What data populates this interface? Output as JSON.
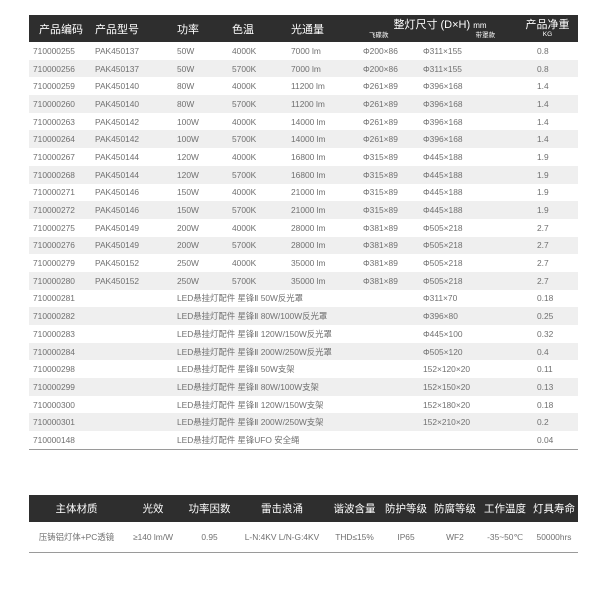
{
  "product_table": {
    "headers": {
      "code": "产品编码",
      "model": "产品型号",
      "power": "功率",
      "color_temp": "色温",
      "lumen": "光通量",
      "size": "整灯尺寸 (D×H)",
      "size_unit": "mm",
      "size_sub1": "飞碟款",
      "size_sub2": "带罩款",
      "weight": "产品净重",
      "weight_unit": "KG"
    },
    "rows": [
      {
        "code": "710000255",
        "model": "PAK450137",
        "power": "50W",
        "cct": "4000K",
        "lumen": "7000 lm",
        "ufo": "Φ200×86",
        "cover": "Φ311×155",
        "acc": "",
        "weight": "0.8"
      },
      {
        "code": "710000256",
        "model": "PAK450137",
        "power": "50W",
        "cct": "5700K",
        "lumen": "7000 lm",
        "ufo": "Φ200×86",
        "cover": "Φ311×155",
        "acc": "",
        "weight": "0.8"
      },
      {
        "code": "710000259",
        "model": "PAK450140",
        "power": "80W",
        "cct": "4000K",
        "lumen": "11200 lm",
        "ufo": "Φ261×89",
        "cover": "Φ396×168",
        "acc": "",
        "weight": "1.4"
      },
      {
        "code": "710000260",
        "model": "PAK450140",
        "power": "80W",
        "cct": "5700K",
        "lumen": "11200 lm",
        "ufo": "Φ261×89",
        "cover": "Φ396×168",
        "acc": "",
        "weight": "1.4"
      },
      {
        "code": "710000263",
        "model": "PAK450142",
        "power": "100W",
        "cct": "4000K",
        "lumen": "14000 lm",
        "ufo": "Φ261×89",
        "cover": "Φ396×168",
        "acc": "",
        "weight": "1.4"
      },
      {
        "code": "710000264",
        "model": "PAK450142",
        "power": "100W",
        "cct": "5700K",
        "lumen": "14000 lm",
        "ufo": "Φ261×89",
        "cover": "Φ396×168",
        "acc": "",
        "weight": "1.4"
      },
      {
        "code": "710000267",
        "model": "PAK450144",
        "power": "120W",
        "cct": "4000K",
        "lumen": "16800 lm",
        "ufo": "Φ315×89",
        "cover": "Φ445×188",
        "acc": "",
        "weight": "1.9"
      },
      {
        "code": "710000268",
        "model": "PAK450144",
        "power": "120W",
        "cct": "5700K",
        "lumen": "16800 lm",
        "ufo": "Φ315×89",
        "cover": "Φ445×188",
        "acc": "",
        "weight": "1.9"
      },
      {
        "code": "710000271",
        "model": "PAK450146",
        "power": "150W",
        "cct": "4000K",
        "lumen": "21000 lm",
        "ufo": "Φ315×89",
        "cover": "Φ445×188",
        "acc": "",
        "weight": "1.9"
      },
      {
        "code": "710000272",
        "model": "PAK450146",
        "power": "150W",
        "cct": "5700K",
        "lumen": "21000 lm",
        "ufo": "Φ315×89",
        "cover": "Φ445×188",
        "acc": "",
        "weight": "1.9"
      },
      {
        "code": "710000275",
        "model": "PAK450149",
        "power": "200W",
        "cct": "4000K",
        "lumen": "28000 lm",
        "ufo": "Φ381×89",
        "cover": "Φ505×218",
        "acc": "",
        "weight": "2.7"
      },
      {
        "code": "710000276",
        "model": "PAK450149",
        "power": "200W",
        "cct": "5700K",
        "lumen": "28000 lm",
        "ufo": "Φ381×89",
        "cover": "Φ505×218",
        "acc": "",
        "weight": "2.7"
      },
      {
        "code": "710000279",
        "model": "PAK450152",
        "power": "250W",
        "cct": "4000K",
        "lumen": "35000 lm",
        "ufo": "Φ381×89",
        "cover": "Φ505×218",
        "acc": "",
        "weight": "2.7"
      },
      {
        "code": "710000280",
        "model": "PAK450152",
        "power": "250W",
        "cct": "5700K",
        "lumen": "35000 lm",
        "ufo": "Φ381×89",
        "cover": "Φ505×218",
        "acc": "",
        "weight": "2.7"
      },
      {
        "code": "710000281",
        "model": "",
        "power": "",
        "cct": "",
        "lumen": "",
        "ufo": "",
        "cover": "Φ311×70",
        "acc": "LED悬挂灯配件 星锋Ⅱ 50W反光罩",
        "weight": "0.18"
      },
      {
        "code": "710000282",
        "model": "",
        "power": "",
        "cct": "",
        "lumen": "",
        "ufo": "",
        "cover": "Φ396×80",
        "acc": "LED悬挂灯配件 星锋Ⅱ 80W/100W反光罩",
        "weight": "0.25"
      },
      {
        "code": "710000283",
        "model": "",
        "power": "",
        "cct": "",
        "lumen": "",
        "ufo": "",
        "cover": "Φ445×100",
        "acc": "LED悬挂灯配件 星锋Ⅱ 120W/150W反光罩",
        "weight": "0.32"
      },
      {
        "code": "710000284",
        "model": "",
        "power": "",
        "cct": "",
        "lumen": "",
        "ufo": "",
        "cover": "Φ505×120",
        "acc": "LED悬挂灯配件 星锋Ⅱ 200W/250W反光罩",
        "weight": "0.4"
      },
      {
        "code": "710000298",
        "model": "",
        "power": "",
        "cct": "",
        "lumen": "",
        "ufo": "",
        "cover": "152×120×20",
        "acc": "LED悬挂灯配件 星锋Ⅱ 50W支架",
        "weight": "0.11"
      },
      {
        "code": "710000299",
        "model": "",
        "power": "",
        "cct": "",
        "lumen": "",
        "ufo": "",
        "cover": "152×150×20",
        "acc": "LED悬挂灯配件 星锋Ⅱ 80W/100W支架",
        "weight": "0.13"
      },
      {
        "code": "710000300",
        "model": "",
        "power": "",
        "cct": "",
        "lumen": "",
        "ufo": "",
        "cover": "152×180×20",
        "acc": "LED悬挂灯配件 星锋Ⅱ 120W/150W支架",
        "weight": "0.18"
      },
      {
        "code": "710000301",
        "model": "",
        "power": "",
        "cct": "",
        "lumen": "",
        "ufo": "",
        "cover": "152×210×20",
        "acc": "LED悬挂灯配件 星锋Ⅱ 200W/250W支架",
        "weight": "0.2"
      },
      {
        "code": "710000148",
        "model": "",
        "power": "",
        "cct": "",
        "lumen": "",
        "ufo": "",
        "cover": "",
        "acc": "LED悬挂灯配件 星锋UFO 安全绳",
        "weight": "0.04"
      }
    ]
  },
  "spec_table": {
    "headers": [
      "主体材质",
      "光效",
      "功率因数",
      "雷击浪涌",
      "谐波含量",
      "防护等级",
      "防腐等级",
      "工作温度",
      "灯具寿命"
    ],
    "values": [
      "压铸铝灯体+PC透镜",
      "≥140 lm/W",
      "0.95",
      "L-N:4KV  L/N-G:4KV",
      "THD≤15%",
      "IP65",
      "WF2",
      "-35~50℃",
      "50000hrs"
    ]
  },
  "colors": {
    "header_bg": "#2e2e2e",
    "header_text": "#ffffff",
    "stripe": "#efefef",
    "text": "#707070"
  }
}
